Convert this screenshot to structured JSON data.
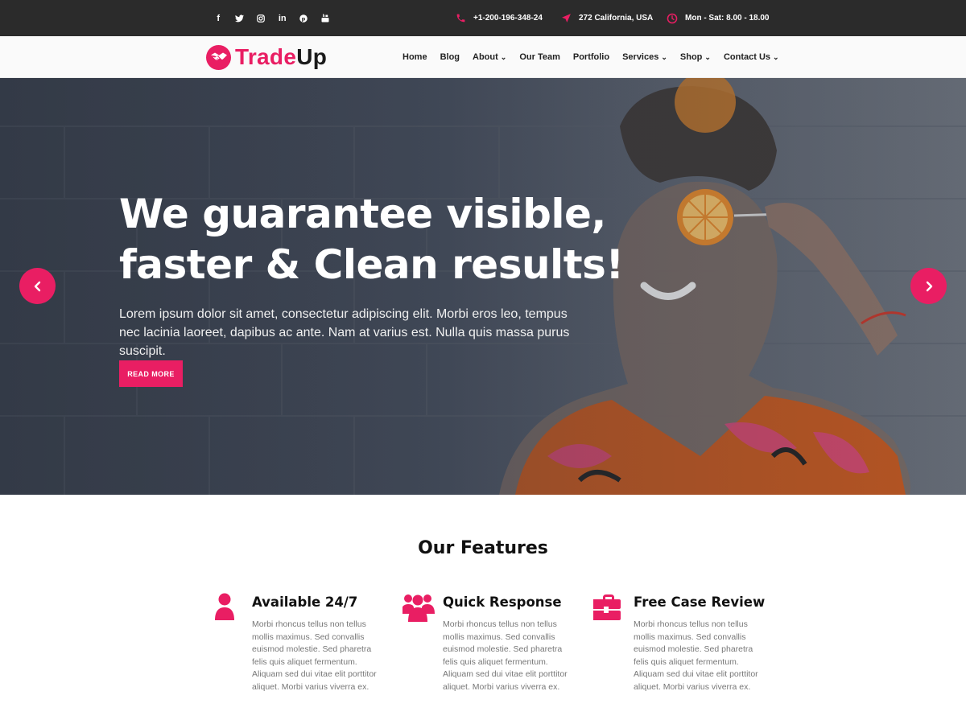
{
  "topbar": {
    "social_icons": [
      "facebook-icon",
      "twitter-icon",
      "instagram-icon",
      "linkedin-icon",
      "pinterest-icon",
      "youtube-icon"
    ],
    "phone": "+1-200-196-348-24",
    "address": "272 California, USA",
    "hours": "Mon - Sat: 8.00 - 18.00"
  },
  "brand": {
    "name_part1": "Trade",
    "name_part2": "Up",
    "accent_color": "#e91e63"
  },
  "nav": {
    "items": [
      {
        "label": "Home",
        "dropdown": false
      },
      {
        "label": "Blog",
        "dropdown": false
      },
      {
        "label": "About",
        "dropdown": true
      },
      {
        "label": "Our Team",
        "dropdown": false
      },
      {
        "label": "Portfolio",
        "dropdown": false
      },
      {
        "label": "Services",
        "dropdown": true
      },
      {
        "label": "Shop",
        "dropdown": true
      },
      {
        "label": "Contact Us",
        "dropdown": true
      }
    ]
  },
  "hero": {
    "title_line1": "We guarantee visible,",
    "title_line2": "faster & Clean results!",
    "text": "Lorem ipsum dolor sit amet, consectetur adipiscing elit. Morbi eros leo, tempus nec lacinia laoreet, dapibus ac ante. Nam at varius est. Nulla quis massa purus suscipit.",
    "button_label": "READ MORE"
  },
  "features": {
    "heading": "Our Features",
    "items": [
      {
        "icon": "user-icon",
        "title": "Available 24/7",
        "text": "Morbi rhoncus tellus non tellus mollis maximus. Sed convallis euismod molestie. Sed pharetra felis quis aliquet fermentum. Aliquam sed dui vitae elit porttitor aliquet. Morbi varius viverra ex."
      },
      {
        "icon": "group-icon",
        "title": "Quick Response",
        "text": "Morbi rhoncus tellus non tellus mollis maximus. Sed convallis euismod molestie. Sed pharetra felis quis aliquet fermentum. Aliquam sed dui vitae elit porttitor aliquet. Morbi varius viverra ex."
      },
      {
        "icon": "briefcase-icon",
        "title": "Free Case Review",
        "text": "Morbi rhoncus tellus non tellus mollis maximus. Sed convallis euismod molestie. Sed pharetra felis quis aliquet fermentum. Aliquam sed dui vitae elit porttitor aliquet. Morbi varius viverra ex."
      }
    ]
  }
}
